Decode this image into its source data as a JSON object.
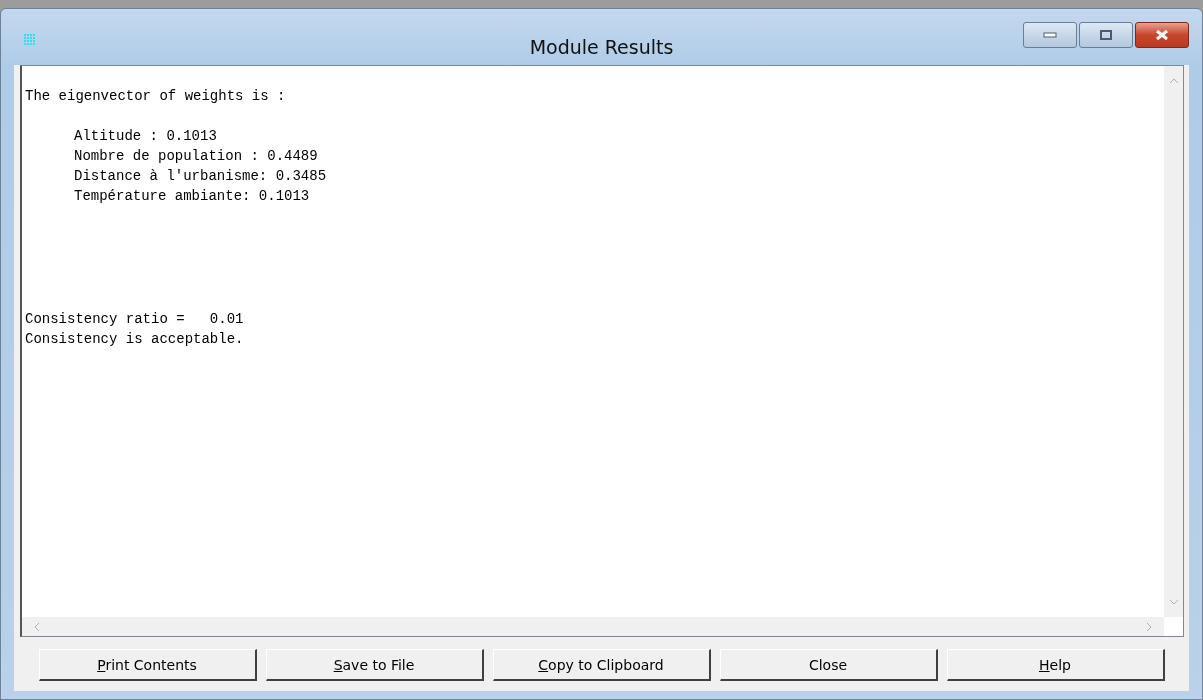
{
  "window": {
    "title": "Module Results"
  },
  "results": {
    "heading": "The eigenvector of weights is :",
    "weights": [
      "Altitude : 0.1013",
      "Nombre de population : 0.4489",
      "Distance à l'urbanisme: 0.3485",
      "Température ambiante: 0.1013"
    ],
    "consistency": [
      "Consistency ratio =   0.01",
      "Consistency is acceptable."
    ]
  },
  "buttons": [
    {
      "label": "Print Contents",
      "underline_first": true
    },
    {
      "label": "Save to File",
      "underline_first": true
    },
    {
      "label": "Copy to Clipboard",
      "underline_first": true
    },
    {
      "label": "Close",
      "underline_first": false
    },
    {
      "label": "Help",
      "underline_first": true
    }
  ]
}
